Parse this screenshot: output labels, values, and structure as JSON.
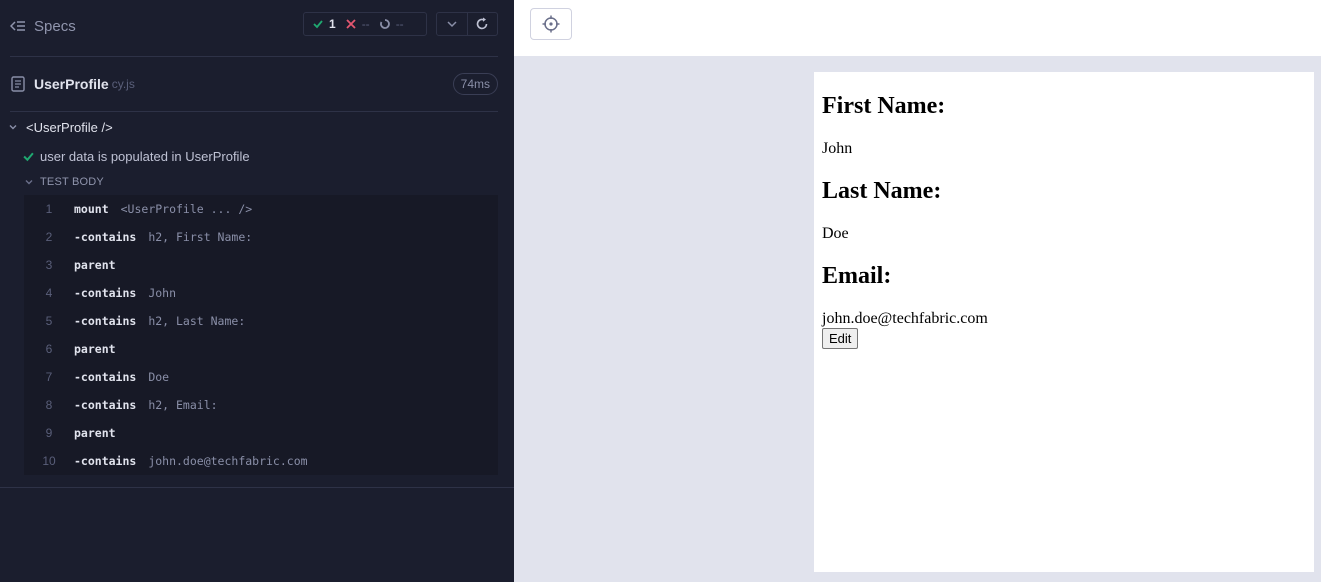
{
  "reporter": {
    "specs_label": "Specs",
    "stats": {
      "passed": "1",
      "failed": "--",
      "pending": "--"
    },
    "spec": {
      "name": "UserProfile",
      "ext": "cy.js",
      "duration": "74ms"
    },
    "suite": {
      "title": "<UserProfile />"
    },
    "test": {
      "title": "user data is populated in UserProfile"
    },
    "test_body_label": "TEST BODY",
    "commands": [
      {
        "num": "1",
        "method": "mount",
        "message": "<UserProfile ... />"
      },
      {
        "num": "2",
        "method": "-contains",
        "message": "h2, First Name:"
      },
      {
        "num": "3",
        "method": "parent",
        "message": ""
      },
      {
        "num": "4",
        "method": "-contains",
        "message": "John"
      },
      {
        "num": "5",
        "method": "-contains",
        "message": "h2, Last Name:"
      },
      {
        "num": "6",
        "method": "parent",
        "message": ""
      },
      {
        "num": "7",
        "method": "-contains",
        "message": "Doe"
      },
      {
        "num": "8",
        "method": "-contains",
        "message": "h2, Email:"
      },
      {
        "num": "9",
        "method": "parent",
        "message": ""
      },
      {
        "num": "10",
        "method": "-contains",
        "message": "john.doe@techfabric.com"
      }
    ]
  },
  "aut": {
    "first_name_label": "First Name:",
    "first_name_value": "John",
    "last_name_label": "Last Name:",
    "last_name_value": "Doe",
    "email_label": "Email:",
    "email_value": "john.doe@techfabric.com",
    "edit_label": "Edit"
  },
  "colors": {
    "pass": "#1fa971",
    "fail": "#e45770",
    "bg_dark": "#1b1e2e",
    "aut_bg": "#e1e3ed"
  },
  "icons": [
    "specs-list-icon",
    "check-icon",
    "x-icon",
    "pending-icon",
    "chevron-down-icon",
    "restart-icon",
    "file-icon",
    "selector-playground-icon"
  ]
}
